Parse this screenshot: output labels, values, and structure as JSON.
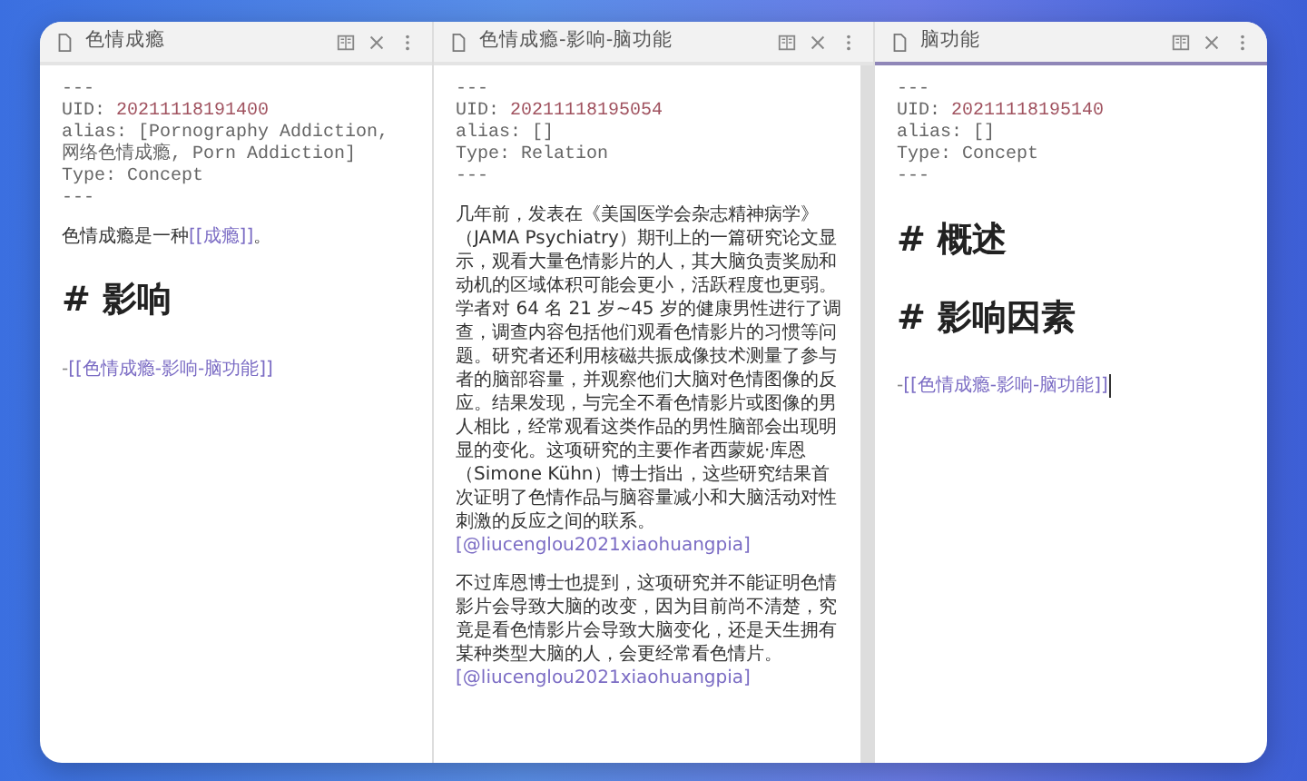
{
  "panes": [
    {
      "title": "色情成瘾",
      "active": false,
      "scrollbar": false,
      "frontmatter": [
        {
          "kind": "fence",
          "text": "---"
        },
        {
          "kind": "uid",
          "key": "UID:",
          "value": "20211118191400"
        },
        {
          "kind": "field",
          "key": "alias:",
          "value": "[Pornography Addiction, 网络色情成瘾, Porn Addiction]"
        },
        {
          "kind": "field",
          "key": "Type:",
          "value": "Concept"
        },
        {
          "kind": "fence",
          "text": "---"
        }
      ],
      "body": [
        {
          "kind": "paragraph",
          "parts": [
            {
              "text": "色情成瘾是一种",
              "link": false
            },
            {
              "text": "[[成瘾]]",
              "link": true
            },
            {
              "text": "。",
              "link": false
            }
          ]
        },
        {
          "kind": "heading",
          "text": "# 影响"
        },
        {
          "kind": "list_item",
          "cursor": false,
          "parts": [
            {
              "text": "- ",
              "link": false
            },
            {
              "text": "[[色情成瘾-影响-脑功能]]",
              "link": true
            }
          ]
        }
      ]
    },
    {
      "title": "色情成瘾-影响-脑功能",
      "active": false,
      "scrollbar": true,
      "frontmatter": [
        {
          "kind": "fence",
          "text": "---"
        },
        {
          "kind": "uid",
          "key": "UID:",
          "value": "20211118195054"
        },
        {
          "kind": "field",
          "key": "alias:",
          "value": "[]"
        },
        {
          "kind": "field",
          "key": "Type:",
          "value": "Relation"
        },
        {
          "kind": "fence",
          "text": "---"
        }
      ],
      "body": [
        {
          "kind": "paragraph",
          "parts": [
            {
              "text": "几年前，发表在《美国医学会杂志精神病学》（JAMA Psychiatry）期刊上的一篇研究论文显示，观看大量色情影片的人，其大脑负责奖励和动机的区域体积可能会更小，活跃程度也更弱。学者对 64 名 21 岁~45 岁的健康男性进行了调查，调查内容包括他们观看色情影片的习惯等问题。研究者还利用核磁共振成像技术测量了参与者的脑部容量，并观察他们大脑对色情图像的反应。结果发现，与完全不看色情影片或图像的男人相比，经常观看这类作品的男性脑部会出现明显的变化。这项研究的主要作者西蒙妮·库恩（Simone Kühn）博士指出，这些研究结果首次证明了色情作品与脑容量减小和大脑活动对性刺激的反应之间的联系。",
              "link": false
            }
          ]
        },
        {
          "kind": "citation",
          "text": "[@liucenglou2021xiaohuangpia]"
        },
        {
          "kind": "paragraph",
          "parts": [
            {
              "text": "不过库恩博士也提到，这项研究并不能证明色情影片会导致大脑的改变，因为目前尚不清楚，究竟是看色情影片会导致大脑变化，还是天生拥有某种类型大脑的人，会更经常看色情片。",
              "link": false
            }
          ]
        },
        {
          "kind": "citation",
          "text": "[@liucenglou2021xiaohuangpia]"
        }
      ]
    },
    {
      "title": "脑功能",
      "active": true,
      "scrollbar": false,
      "frontmatter": [
        {
          "kind": "fence",
          "text": "---"
        },
        {
          "kind": "uid",
          "key": "UID:",
          "value": "20211118195140"
        },
        {
          "kind": "field",
          "key": "alias:",
          "value": "[]"
        },
        {
          "kind": "field",
          "key": "Type:",
          "value": "Concept"
        },
        {
          "kind": "fence",
          "text": "---"
        }
      ],
      "body": [
        {
          "kind": "heading",
          "text": "# 概述"
        },
        {
          "kind": "heading",
          "text": "# 影响因素"
        },
        {
          "kind": "list_item",
          "cursor": true,
          "parts": [
            {
              "text": "- ",
              "link": false
            },
            {
              "text": "[[色情成瘾-影响-脑功能]]",
              "link": true
            }
          ]
        }
      ]
    }
  ]
}
